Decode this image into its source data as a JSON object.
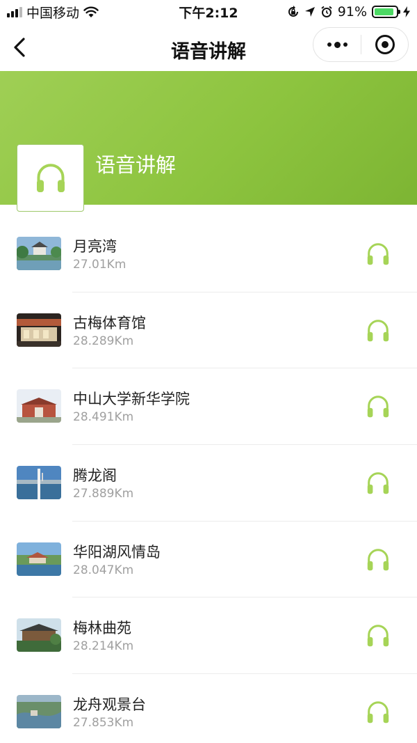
{
  "status": {
    "carrier": "中国移动",
    "time": "下午2:12",
    "battery": "91%",
    "battery_level": 0.91
  },
  "nav": {
    "title": "语音讲解"
  },
  "banner": {
    "title": "语音讲解"
  },
  "colors": {
    "accent": "#8dc43f",
    "icon": "#a6d457"
  },
  "items": [
    {
      "name": "月亮湾",
      "distance": "27.01Km",
      "icon": "headphones-icon"
    },
    {
      "name": "古梅体育馆",
      "distance": "28.289Km",
      "icon": "headphones-icon"
    },
    {
      "name": "中山大学新华学院",
      "distance": "28.491Km",
      "icon": "headphones-icon"
    },
    {
      "name": "腾龙阁",
      "distance": "27.889Km",
      "icon": "headphones-icon"
    },
    {
      "name": "华阳湖风情岛",
      "distance": "28.047Km",
      "icon": "headphones-icon"
    },
    {
      "name": "梅林曲苑",
      "distance": "28.214Km",
      "icon": "headphones-icon"
    },
    {
      "name": "龙舟观景台",
      "distance": "27.853Km",
      "icon": "headphones-icon"
    }
  ]
}
